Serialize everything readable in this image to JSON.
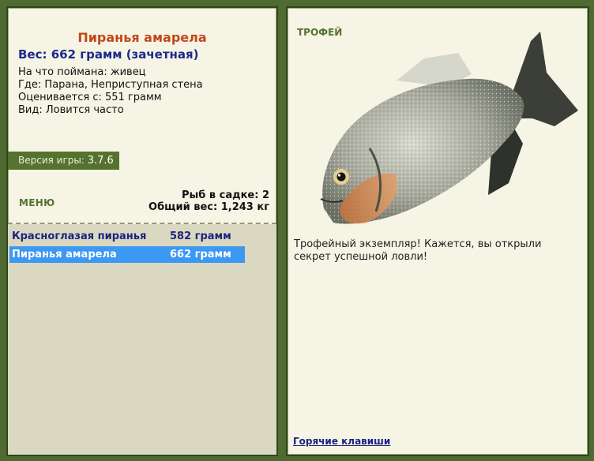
{
  "fish": {
    "title": "Пиранья амарела",
    "weight_line": "Вес: 662 грамм (зачетная)",
    "info": [
      "На что поймана: живец",
      "Где: Парана, Неприступная стена",
      "Оценивается с: 551 грамм",
      "Вид: Ловится часто"
    ]
  },
  "version": {
    "label": "Версия игры:",
    "value": "3.7.6"
  },
  "menu": {
    "label": "МЕНЮ"
  },
  "catch": {
    "count_line": "Рыб в садке: 2",
    "total_line": "Общий вес: 1,243 кг"
  },
  "list": [
    {
      "name": "Красноглазая пиранья",
      "weight": "582 грамм",
      "selected": false
    },
    {
      "name": "Пиранья амарела",
      "weight": "662 грамм",
      "selected": true
    }
  ],
  "trophy": {
    "label": "ТРОФЕЙ",
    "text": "Трофейный экземпляр! Кажется, вы открыли секрет успешной ловли!"
  },
  "hotkeys": {
    "label": "Горячие клавиши"
  }
}
